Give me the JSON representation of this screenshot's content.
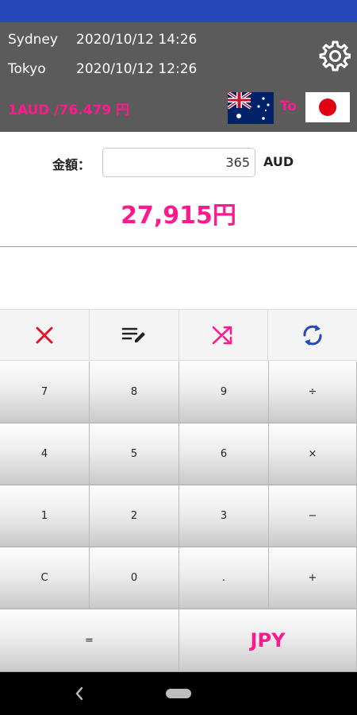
{
  "header": {
    "cities": [
      {
        "name": "Sydney",
        "datetime": "2020/10/12 14:26"
      },
      {
        "name": "Tokyo",
        "datetime": "2020/10/12 12:26"
      }
    ],
    "rate": "1AUD /76.479 円",
    "to_label": "To",
    "from_flag": "australia-flag",
    "to_flag": "japan-flag"
  },
  "converter": {
    "amount_label": "金額：",
    "amount_value": "365",
    "amount_unit": "AUD",
    "result": "27,915円"
  },
  "toolbar": [
    {
      "icon": "clear-icon",
      "color": "#e0162b"
    },
    {
      "icon": "edit-list-icon",
      "color": "#222222"
    },
    {
      "icon": "shuffle-icon",
      "color": "#ff1a8c"
    },
    {
      "icon": "refresh-icon",
      "color": "#2548b8"
    }
  ],
  "keypad": {
    "rows": [
      [
        "7",
        "8",
        "9",
        "÷"
      ],
      [
        "4",
        "5",
        "6",
        "×"
      ],
      [
        "1",
        "2",
        "3",
        "−"
      ],
      [
        "C",
        "0",
        ".",
        "+"
      ]
    ],
    "equals": "=",
    "target_currency": "JPY"
  },
  "colors": {
    "status_bar": "#2548b8",
    "header_bg": "#5b5b5b",
    "accent": "#ff1a8c"
  }
}
